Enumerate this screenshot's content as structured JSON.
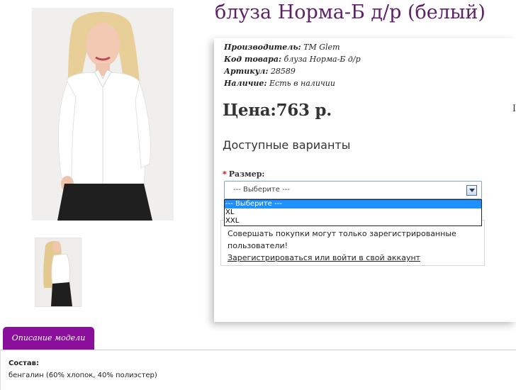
{
  "product": {
    "title": "блуза Норма-Б д/р (белый)",
    "manufacturer_label": "Производитель:",
    "manufacturer": "ТМ Glem",
    "code_label": "Код товара:",
    "code": "блуза Норма-Б д/р",
    "article_label": "Артикул:",
    "article": "28589",
    "availability_label": "Наличие:",
    "availability": "Есть в наличии",
    "price_label": "Цена:",
    "price": "763 р.",
    "edge_mark": "I"
  },
  "options": {
    "heading": "Доступные варианты",
    "required_mark": "*",
    "size_label": "Размер:",
    "selected": "--- Выберите ---",
    "items": [
      "--- Выберите ---",
      "XL",
      "XXL"
    ]
  },
  "notice": {
    "text": "Совершать покупки могут только зарегистрированные пользователи!",
    "link": "Зарегистрироваться или войти в свой аккаунт"
  },
  "tabs": {
    "description": "Описание модели"
  },
  "description": {
    "heading": "Состав:",
    "composition": "бенгалин (60% хлопок, 40% полиэстер)"
  },
  "colors": {
    "title": "#5e2168",
    "tab": "#8a0f9a",
    "selected_option": "#1e90ff",
    "required": "#c00000"
  }
}
